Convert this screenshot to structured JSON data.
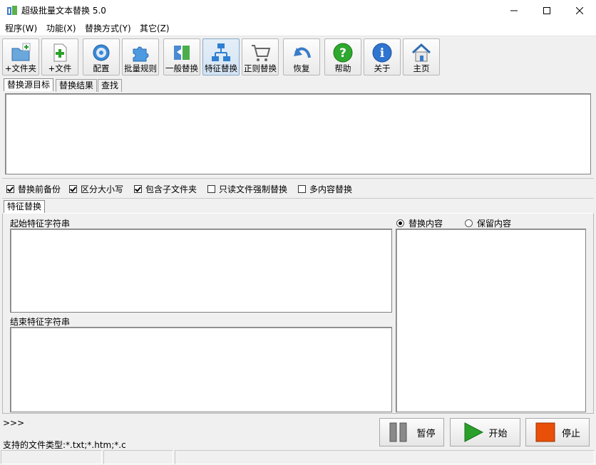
{
  "window": {
    "title": "超级批量文本替换 5.0"
  },
  "menu": [
    "程序(W)",
    "功能(X)",
    "替换方式(Y)",
    "其它(Z)"
  ],
  "toolbar": {
    "buttons": [
      "+文件夹",
      "+文件",
      "配置",
      "批量规则",
      "一般替换",
      "特征替换",
      "正则替换",
      "恢复",
      "帮助",
      "关于",
      "主页"
    ]
  },
  "top_tabs": [
    "替换源目标",
    "替换结果",
    "查找"
  ],
  "options": [
    "替换前备份",
    "区分大小写",
    "包含子文件夹",
    "只读文件强制替换",
    "多内容替换"
  ],
  "options_state": [
    true,
    true,
    true,
    false,
    false
  ],
  "mode_tab": "特征替换",
  "labels": {
    "start": "起始特征字符串",
    "end": "结束特征字符串"
  },
  "radios": [
    "替换内容",
    "保留内容"
  ],
  "radio_selected": 0,
  "log": {
    "prompt": ">>>",
    "file_types": "支持的文件类型:*.txt;*.htm;*.c"
  },
  "actions": {
    "pause": "暂停",
    "start": "开始",
    "stop": "停止"
  },
  "colors": {
    "pause": "#8a8a8a",
    "start": "#2aa02a",
    "stop": "#e8500a",
    "panel_border": "#828282"
  }
}
